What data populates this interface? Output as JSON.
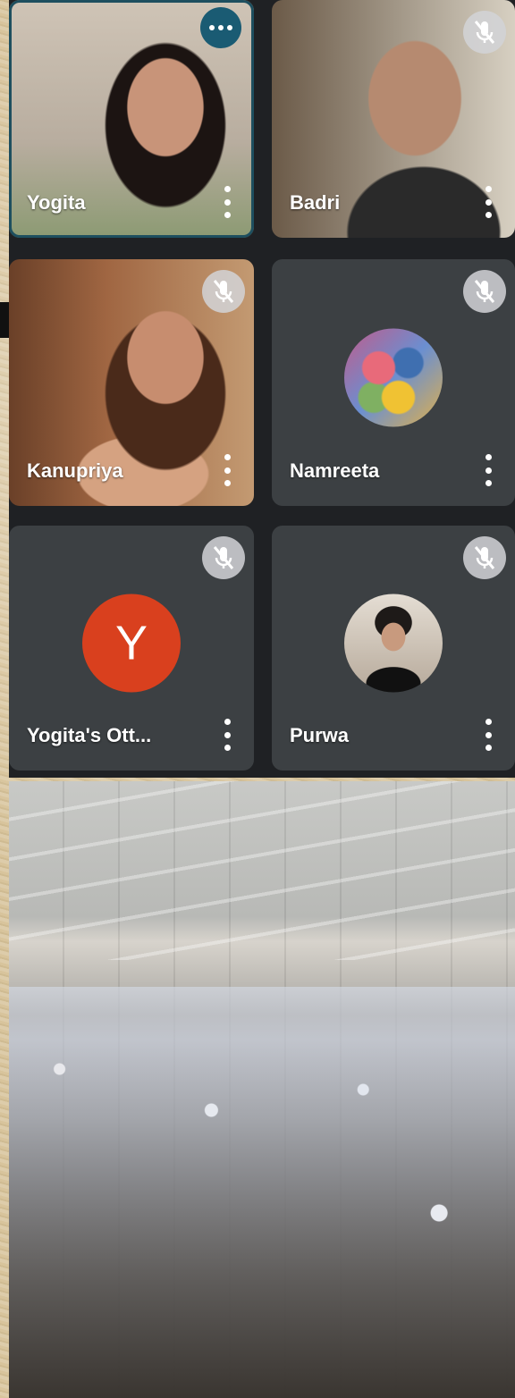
{
  "participants": [
    {
      "name": "Yogita",
      "state": "speaking"
    },
    {
      "name": "Badri",
      "state": "muted"
    },
    {
      "name": "Kanupriya",
      "state": "muted"
    },
    {
      "name": "Namreeta",
      "state": "muted"
    },
    {
      "name": "Yogita's Ott...",
      "state": "muted",
      "avatar_letter": "Y"
    },
    {
      "name": "Purwa",
      "state": "muted"
    }
  ],
  "icons": {
    "mute": "mic-off-icon",
    "more": "more-vert-icon",
    "speaking": "audio-activity-icon"
  },
  "colors": {
    "meet_background": "#1f2124",
    "tile_background": "#3c4043",
    "avatar_letter_bg": "#d9401e",
    "speaking_indicator": "#1a5b73"
  }
}
